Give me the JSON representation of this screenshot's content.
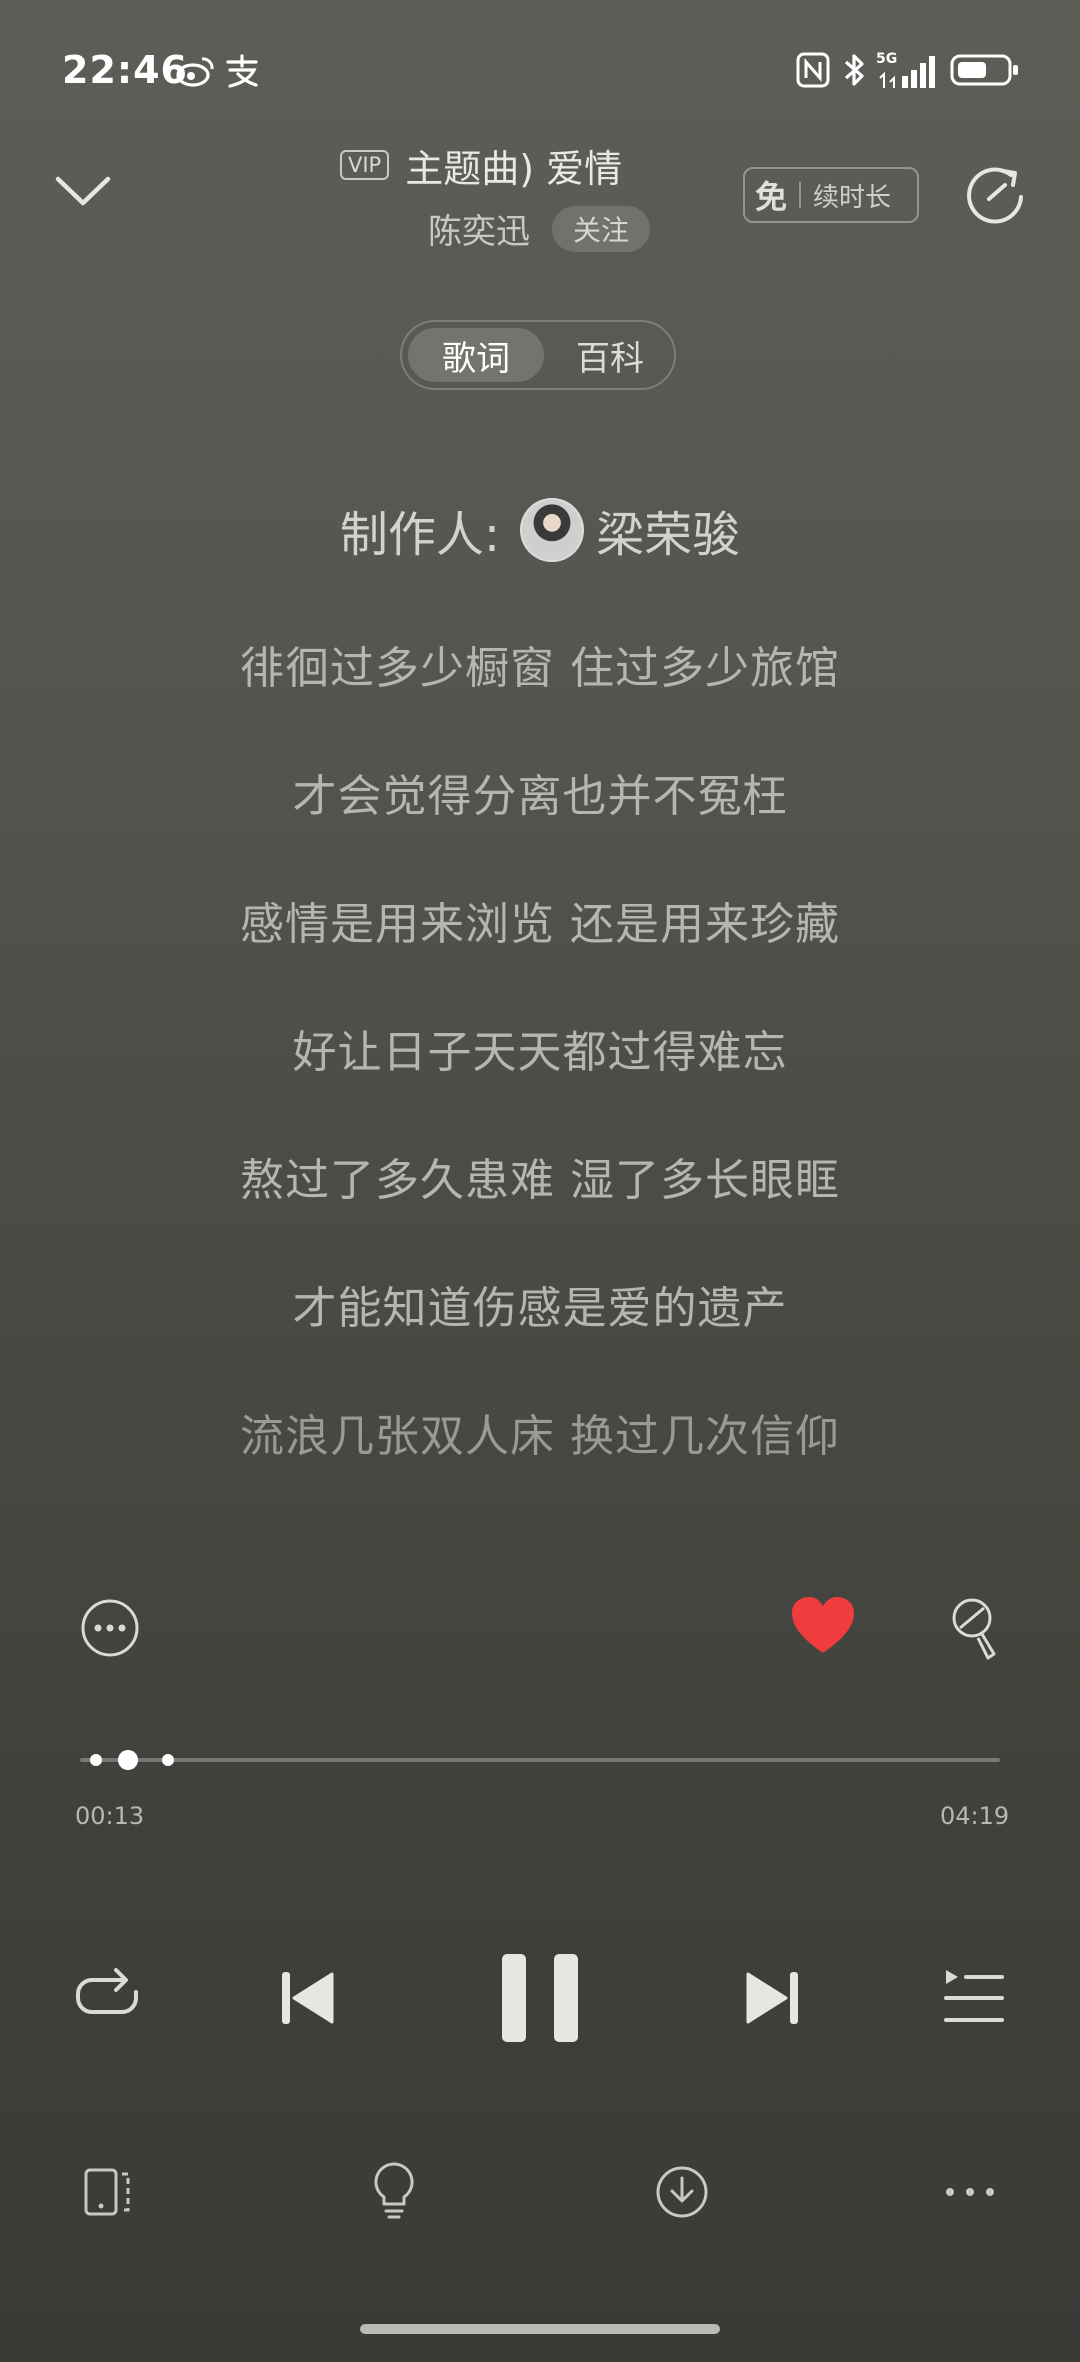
{
  "status_bar": {
    "time": "22:46",
    "left_icons": [
      "weibo-icon",
      "alipay-icon"
    ],
    "right_icons": [
      "nfc-icon",
      "bluetooth-icon",
      "signal-5g-icon",
      "battery-icon"
    ],
    "network_label": "5G"
  },
  "header": {
    "vip_label": "VIP",
    "song_title": "主题曲)       爱情",
    "artist": "陈奕迅",
    "follow_label": "关注",
    "free_char": "免",
    "free_label": "续时长"
  },
  "tabs": [
    {
      "label": "歌词",
      "active": true
    },
    {
      "label": "百科",
      "active": false
    }
  ],
  "lyrics": {
    "producer_label": "制作人:",
    "producer_name": "梁荣骏",
    "lines": [
      "徘徊过多少橱窗 住过多少旅馆",
      "才会觉得分离也并不冤枉",
      "感情是用来浏览 还是用来珍藏",
      "好让日子天天都过得难忘",
      "熬过了多久患难 湿了多长眼眶",
      "才能知道伤感是爱的遗产",
      "流浪几张双人床 换过几次信仰"
    ]
  },
  "player": {
    "current_time": "00:13",
    "total_time": "04:19",
    "progress_fraction": 0.05,
    "liked": true,
    "accent_color": "#f03c3c"
  }
}
